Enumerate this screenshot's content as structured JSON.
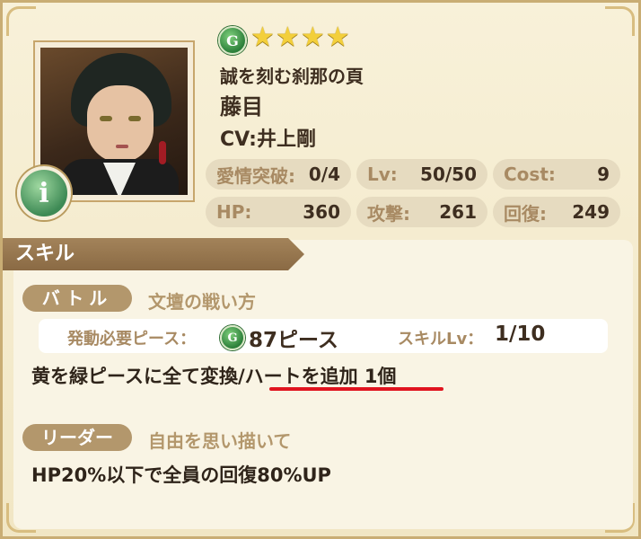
{
  "card": {
    "rarity_badge": "G",
    "stars": [
      "★",
      "★",
      "★",
      "★"
    ],
    "title": "誠を刻む刹那の頁",
    "name": "藤目",
    "cv": "CV:井上剛",
    "info_button": "i"
  },
  "stats": {
    "affection": {
      "label": "愛情突破:",
      "value": "0/4"
    },
    "lv": {
      "label": "Lv:",
      "value": "50/50"
    },
    "cost": {
      "label": "Cost:",
      "value": "9"
    },
    "hp": {
      "label": "HP:",
      "value": "360"
    },
    "attack": {
      "label": "攻撃:",
      "value": "261"
    },
    "recovery": {
      "label": "回復:",
      "value": "249"
    }
  },
  "skill": {
    "section_title": "スキル",
    "battle": {
      "tag": "バトル",
      "name": "文壇の戦い方",
      "required_label": "発動必要ピース：",
      "required_badge": "G",
      "required_value": "87ピース",
      "level_label": "スキルLv：",
      "level_value": "1/10",
      "effect_prefix": "黄を緑ピースに全て変換/",
      "effect_highlight": "ハートを追加 1個",
      "highlight_color": "#e0141f"
    },
    "leader": {
      "tag": "リーダー",
      "name": "自由を思い描いて",
      "effect": "HP20%以下で全員の回復80%UP"
    }
  }
}
